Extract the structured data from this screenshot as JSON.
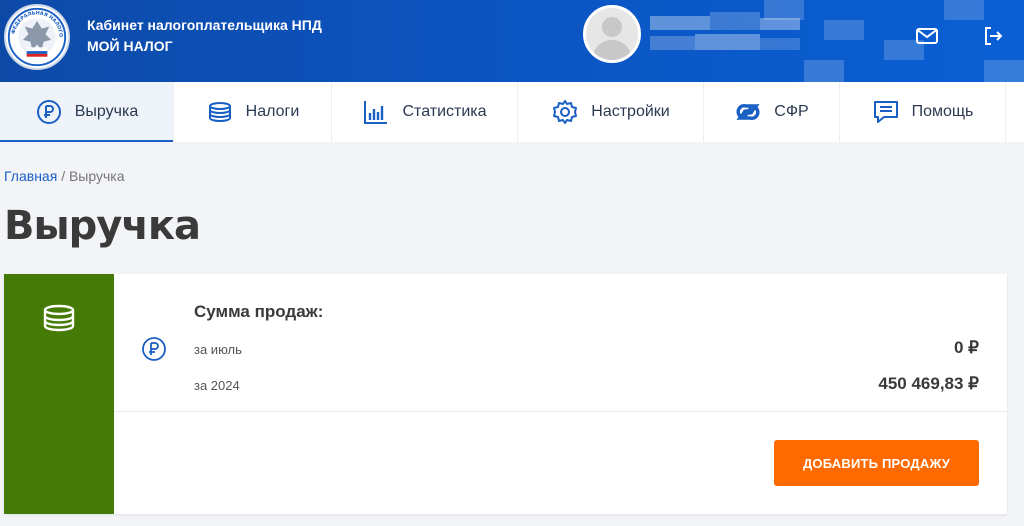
{
  "header": {
    "title_line1": "Кабинет налогоплательщика НПД",
    "title_line2": "МОЙ НАЛОГ",
    "logo_text": "ФЕДЕРАЛЬНАЯ НАЛОГОВАЯ СЛУЖБА",
    "icons": [
      "mail-icon",
      "logout-icon"
    ]
  },
  "nav": [
    {
      "label": "Выручка",
      "icon": "ruble-circle-icon",
      "active": true
    },
    {
      "label": "Налоги",
      "icon": "coins-stack-icon",
      "active": false
    },
    {
      "label": "Статистика",
      "icon": "bar-chart-icon",
      "active": false
    },
    {
      "label": "Настройки",
      "icon": "gear-icon",
      "active": false
    },
    {
      "label": "СФР",
      "icon": "sfr-logo-icon",
      "active": false
    },
    {
      "label": "Помощь",
      "icon": "help-chat-icon",
      "active": false
    }
  ],
  "breadcrumb": {
    "home": "Главная",
    "separator": "/",
    "current": "Выручка"
  },
  "page": {
    "title": "Выручка"
  },
  "card": {
    "title": "Сумма продаж:",
    "rows": [
      {
        "label": "за июль",
        "value": "0 ₽"
      },
      {
        "label": "за 2024",
        "value": "450 469,83 ₽"
      }
    ],
    "button": "ДОБАВИТЬ ПРОДАЖУ"
  },
  "colors": {
    "header_blue": "#0b56c4",
    "accent_blue": "#1a5fc4",
    "card_green": "#447a05",
    "button_orange": "#ff6a00"
  }
}
